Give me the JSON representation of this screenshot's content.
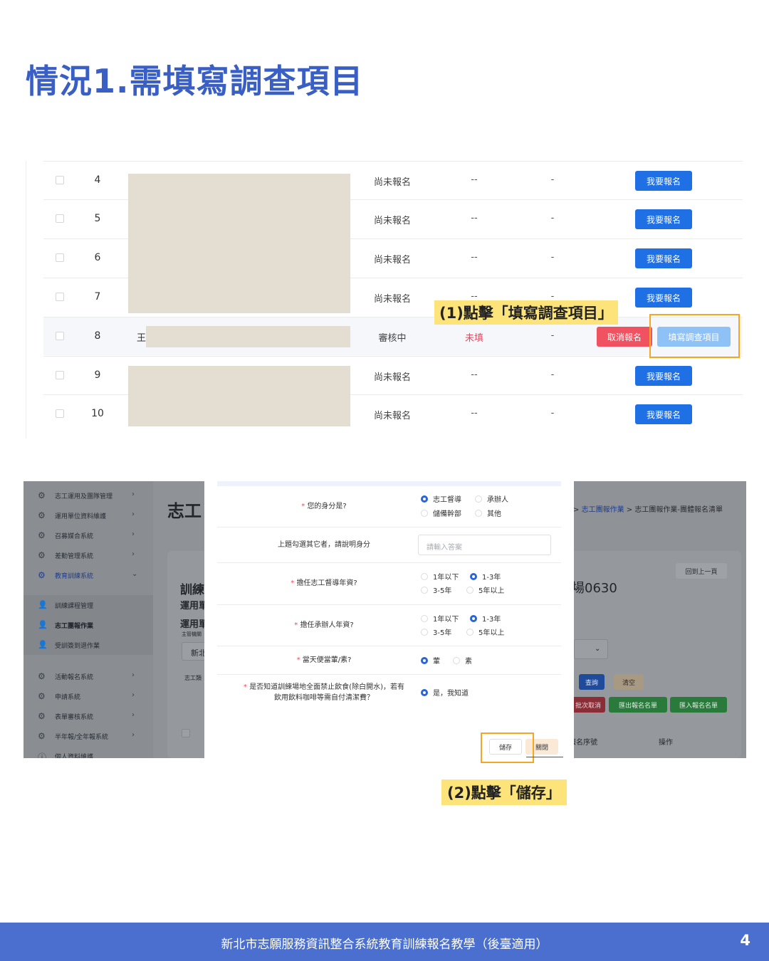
{
  "title": "情況1.需填寫調查項目",
  "table": {
    "rows": [
      {
        "num": "4",
        "status": "尚未報名",
        "survey": "--",
        "dash": "-",
        "action": "我要報名"
      },
      {
        "num": "5",
        "status": "尚未報名",
        "survey": "--",
        "dash": "-",
        "action": "我要報名"
      },
      {
        "num": "6",
        "status": "尚未報名",
        "survey": "--",
        "dash": "-",
        "action": "我要報名"
      },
      {
        "num": "7",
        "status": "尚未報名",
        "survey": "--",
        "dash": "-",
        "action": "我要報名"
      },
      {
        "num": "8",
        "name_char": "王",
        "status": "審核中",
        "survey": "未填",
        "dash": "-",
        "cancel": "取消報名",
        "fill": "填寫調查項目"
      },
      {
        "num": "9",
        "status": "尚未報名",
        "survey": "--",
        "dash": "-",
        "action": "我要報名"
      },
      {
        "num": "10",
        "status": "尚未報名",
        "survey": "--",
        "dash": "-",
        "action": "我要報名"
      }
    ]
  },
  "callout1": "(1)點擊「填寫調查項目」",
  "callout2": "(2)點擊「儲存」",
  "sidebar": {
    "items": [
      {
        "label": "志工運用及團隊管理"
      },
      {
        "label": "運用單位資料維護"
      },
      {
        "label": "召募媒合系統"
      },
      {
        "label": "差勤管理系統"
      },
      {
        "label": "教育訓練系統"
      }
    ],
    "subitems": [
      {
        "label": "訓練課程管理"
      },
      {
        "label": "志工團報作業"
      },
      {
        "label": "受訓簽到退作業"
      }
    ],
    "items2": [
      {
        "label": "活動報名系統"
      },
      {
        "label": "申請系統"
      },
      {
        "label": "表單審核系統"
      },
      {
        "label": "半年報/全年報系統"
      },
      {
        "label": "個人資料維護"
      }
    ]
  },
  "background": {
    "title": "志工",
    "breadcrumb_sep": ">",
    "breadcrumb_link": "志工團報作業",
    "breadcrumb_tail": "志工團報作業-團體報名清單",
    "back_button": "回到上一頁",
    "course_code": "場0630",
    "label_train": "訓練",
    "label_unit1": "運用單",
    "label_unit2": "運用單",
    "label_org": "主管機關",
    "label_new": "新北",
    "label_volunteer": "志工類",
    "search_button": "查詢",
    "clear_button": "清空",
    "batch_cancel": "批次取消",
    "export_button": "匯出報名名單",
    "import_button": "匯入報名名單",
    "col_serial": "報名序號",
    "col_action": "操作"
  },
  "modal": {
    "q1": {
      "label": "您的身分是?",
      "options": [
        "志工督導",
        "承辦人",
        "儲備幹部",
        "其他"
      ]
    },
    "q2": {
      "label": "上題勾選其它者，請說明身分",
      "placeholder": "請輸入答案"
    },
    "q3": {
      "label": "擔任志工督導年資?",
      "options": [
        "1年以下",
        "1-3年",
        "3-5年",
        "5年以上"
      ]
    },
    "q4": {
      "label": "擔任承辦人年資?",
      "options": [
        "1年以下",
        "1-3年",
        "3-5年",
        "5年以上"
      ]
    },
    "q5": {
      "label": "當天便當葷/素?",
      "options": [
        "葷",
        "素"
      ]
    },
    "q6": {
      "label_line1": "是否知道訓練場地全面禁止飲食(除白開水)，若有",
      "label_line2": "飲用飲料咖啡等需自付清潔費？",
      "options": [
        "是，我知道"
      ]
    },
    "required_mark": "*",
    "save": "儲存",
    "close": "關閉"
  },
  "footer": {
    "text": "新北市志願服務資訊整合系統教育訓練報名教學（後臺適用）",
    "page": "4"
  },
  "colors": {
    "title": "#3a5fc4",
    "primary_button": "#1f6fe5",
    "danger_button": "#f05261",
    "highlight": "#f5a623",
    "callout": "#fde47a",
    "footer": "#4a6fcf"
  }
}
